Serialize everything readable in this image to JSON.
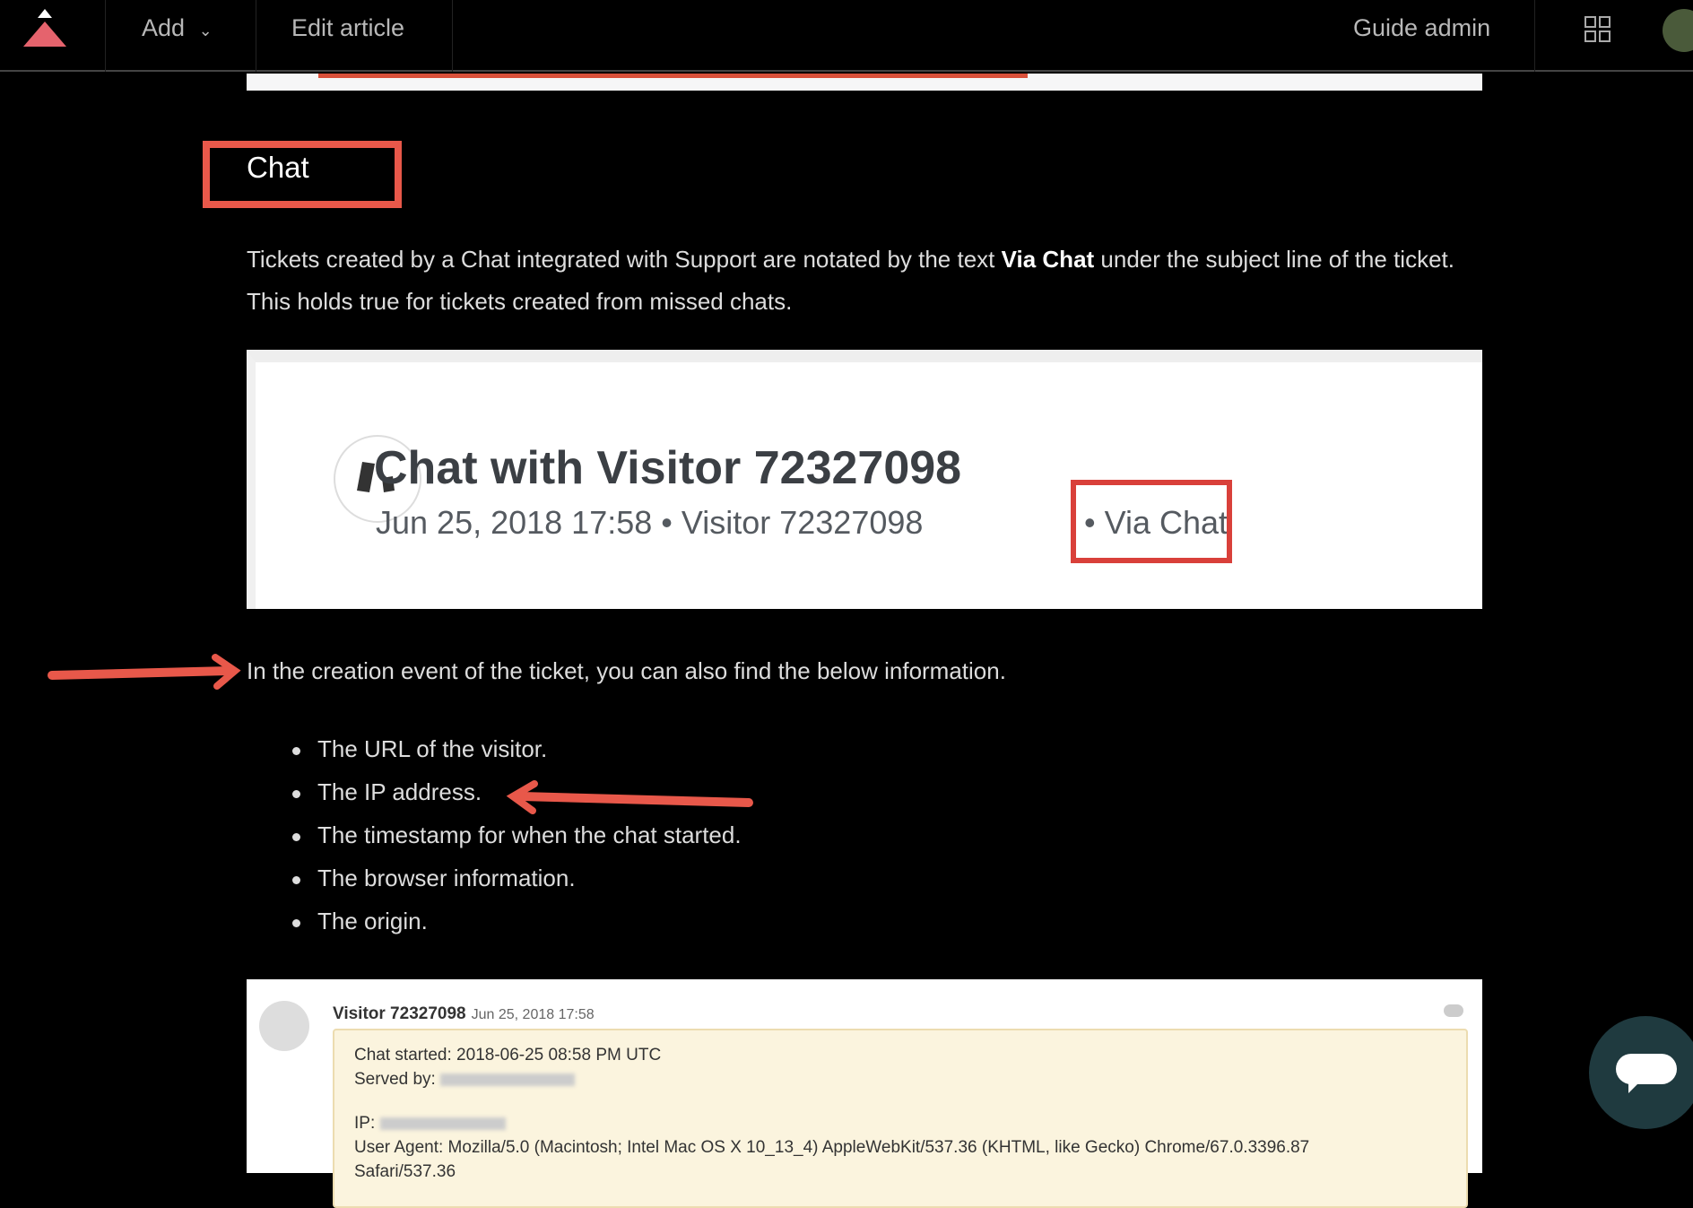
{
  "header": {
    "add_label": "Add",
    "edit_label": "Edit article",
    "admin_label": "Guide admin",
    "icons": [
      "logo-icon",
      "chevron-down-icon",
      "apps-grid-icon",
      "avatar"
    ]
  },
  "article": {
    "heading": "Chat",
    "para1_pre": "Tickets created by a Chat integrated with Support are notated by the text ",
    "para1_bold": "Via Chat",
    "para1_post": " under the subject line of the ticket. This holds true for tickets created from missed chats.",
    "para2": "In the creation event of the ticket, you can also find the below information.",
    "bullets": [
      "The URL of the visitor.",
      "The IP address.",
      "The timestamp for when the chat started.",
      "The browser information.",
      "The origin."
    ]
  },
  "screenshot1": {
    "title": "Chat with Visitor 72327098",
    "subtitle": "Jun 25, 2018 17:58 • Visitor 72327098",
    "via": "• Via Chat"
  },
  "screenshot2": {
    "name": "Visitor 72327098",
    "date": "Jun 25, 2018 17:58",
    "chat_started": "Chat started: 2018-06-25 08:58 PM UTC",
    "served_by": "Served by:",
    "ip": "IP:",
    "user_agent": "User Agent: Mozilla/5.0 (Macintosh; Intel Mac OS X 10_13_4) AppleWebKit/537.36 (KHTML, like Gecko) Chrome/67.0.3396.87",
    "user_agent2": "Safari/537.36"
  },
  "colors": {
    "annotation": "#e8584a",
    "fab": "#1f3a3f"
  }
}
